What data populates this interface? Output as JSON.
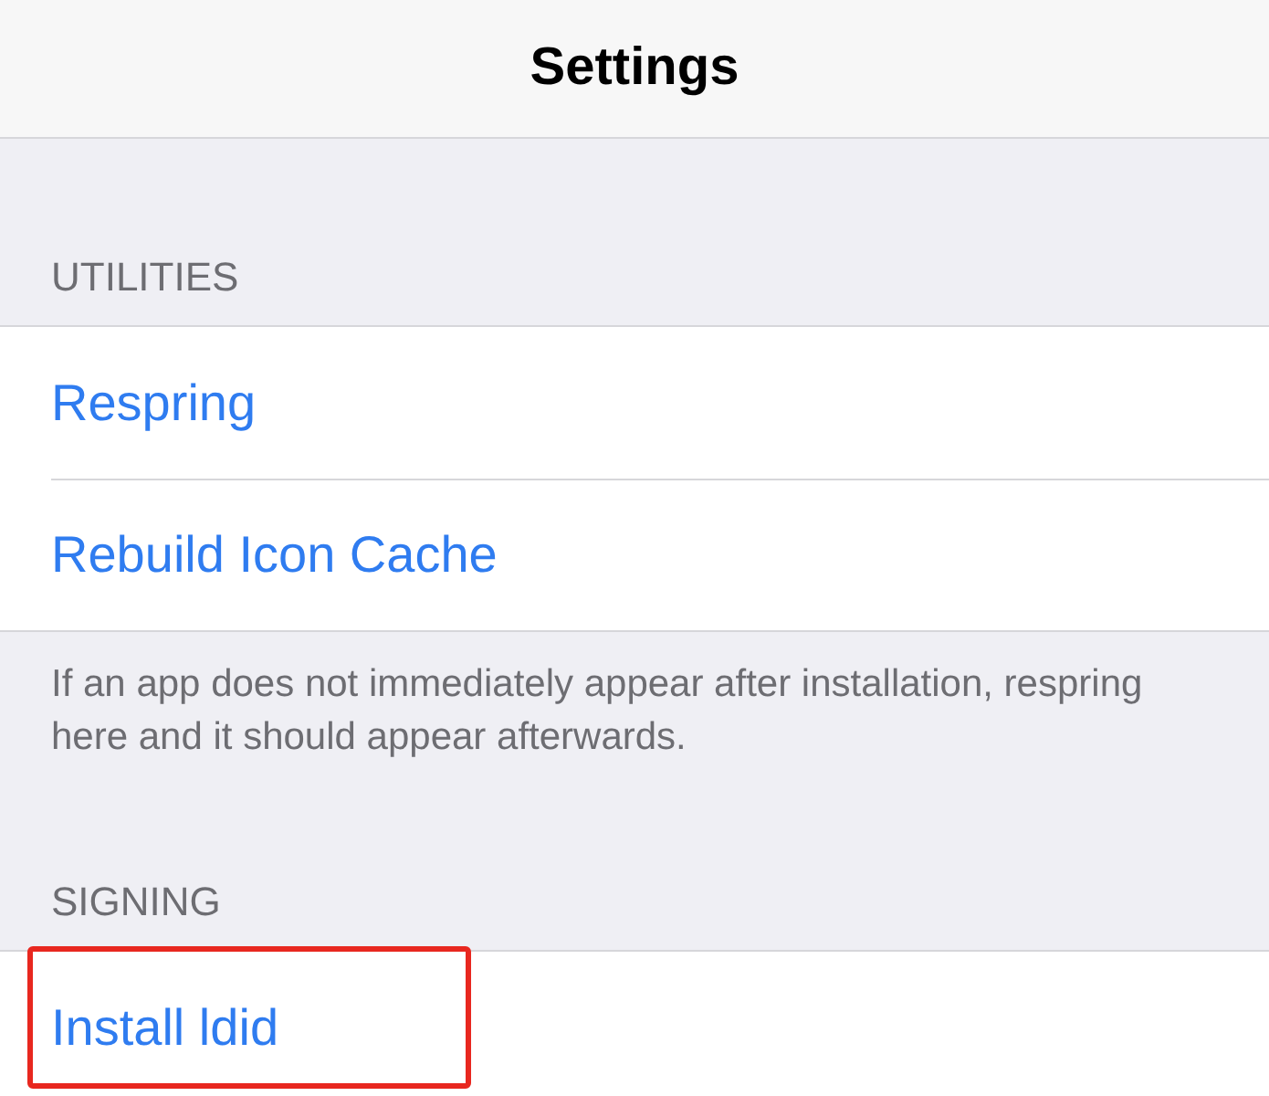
{
  "nav_bar": {
    "title": "Settings"
  },
  "sections": [
    {
      "header": "UTILITIES",
      "rows": [
        {
          "label": "Respring",
          "highlighted": false
        },
        {
          "label": "Rebuild Icon Cache",
          "highlighted": false
        }
      ],
      "footer": "If an app does not immediately appear after installation, respring here and it should appear afterwards."
    },
    {
      "header": "SIGNING",
      "rows": [
        {
          "label": "Install ldid",
          "highlighted": true
        }
      ]
    }
  ]
}
